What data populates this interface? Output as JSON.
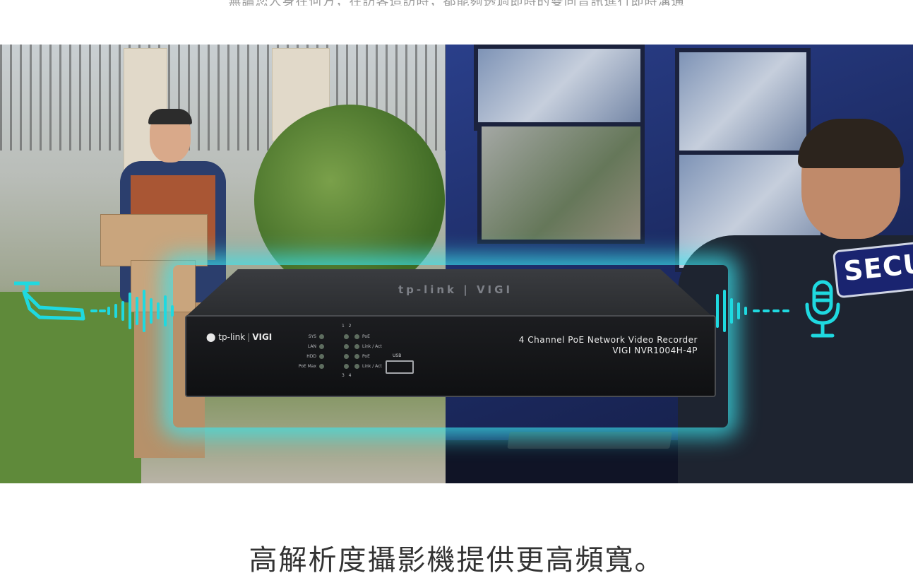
{
  "top_caption": "無論您人身在何方，在訪客造訪時，都能夠透過即時的雙向音訊進行即時溝通",
  "hero": {
    "nvr": {
      "top_logo": "tp-link | VIGI",
      "brand_name": "tp-link",
      "brand_separator": "|",
      "brand_product": "VIGI",
      "model_title": "4 Channel PoE Network Video Recorder",
      "model_number": "VIGI NVR1004H-4P",
      "led_labels_left": [
        "SYS",
        "LAN",
        "HDD",
        "PoE Max"
      ],
      "led_labels_right": [
        "PoE",
        "Link / Act",
        "PoE",
        "Link / Act"
      ],
      "port_numbers_top": [
        "1",
        "2"
      ],
      "port_numbers_bottom": [
        "3",
        "4"
      ],
      "usb_label": "USB"
    },
    "guard_badge_text": "SECU",
    "icons": {
      "left": "security-camera-icon",
      "right": "microphone-icon"
    },
    "accent_color": "#1fd9e0"
  },
  "section_heading": "高解析度攝影機提供更高頻寬。"
}
